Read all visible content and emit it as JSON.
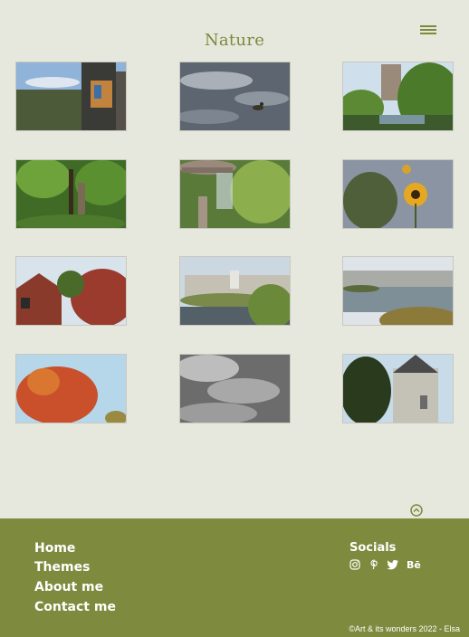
{
  "header": {
    "title": "Nature"
  },
  "gallery": {
    "images": [
      {
        "name": "city-mural-photo"
      },
      {
        "name": "pond-duck-photo"
      },
      {
        "name": "river-trees-photo"
      },
      {
        "name": "forest-path-photo"
      },
      {
        "name": "fountain-photo"
      },
      {
        "name": "sunflower-photo"
      },
      {
        "name": "red-house-photo"
      },
      {
        "name": "city-skyline-photo"
      },
      {
        "name": "river-view-photo"
      },
      {
        "name": "autumn-tree-photo"
      },
      {
        "name": "frost-photo"
      },
      {
        "name": "castle-building-photo"
      }
    ]
  },
  "footer": {
    "nav": [
      "Home",
      "Themes",
      "About me",
      "Contact me"
    ],
    "socials_title": "Socials",
    "social_icons": [
      "instagram-icon",
      "pinterest-icon",
      "twitter-icon",
      "behance-icon"
    ],
    "behance_label": "Bē",
    "copyright": "©Art & its wonders 2022 - Elsa"
  },
  "colors": {
    "background": "#e6e7dd",
    "accent": "#7e8a3d"
  }
}
